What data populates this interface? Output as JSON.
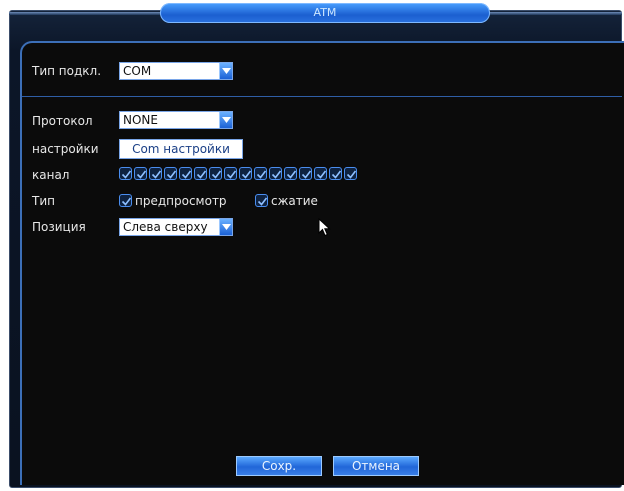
{
  "window": {
    "title": "ATM"
  },
  "form": {
    "connection_type": {
      "label": "Тип подкл.",
      "value": "COM"
    },
    "protocol": {
      "label": "Протокол",
      "value": "NONE"
    },
    "settings": {
      "label": "настройки",
      "button_label": "Com настройки"
    },
    "channel": {
      "label": "канал",
      "channel_count": 16,
      "checked": true
    },
    "type": {
      "label": "Тип",
      "preview_label": "предпросмотр",
      "preview_checked": true,
      "compress_label": "сжатие",
      "compress_checked": true
    },
    "position": {
      "label": "Позиция",
      "value": "Слева сверху"
    }
  },
  "footer": {
    "save_label": "Сохр.",
    "cancel_label": "Отмена"
  },
  "colors": {
    "accent": "#1c62d6",
    "panel_bg": "#0b0b0b",
    "border": "#3c6fb8"
  },
  "icons": {
    "dropdown": "chevron-down-icon",
    "checkbox": "check-icon",
    "cursor": "mouse-pointer-icon"
  }
}
